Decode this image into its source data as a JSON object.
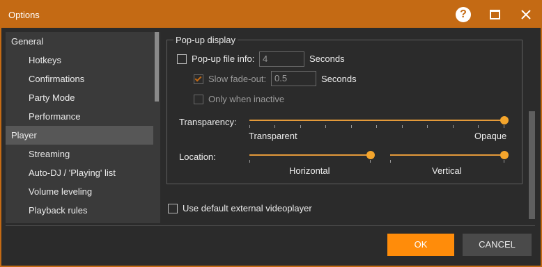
{
  "window": {
    "title": "Options"
  },
  "titlebar": {
    "help_glyph": "?",
    "close_glyph": "✕"
  },
  "sidebar": {
    "items": [
      {
        "label": "General",
        "level": 0
      },
      {
        "label": "Hotkeys",
        "level": 1
      },
      {
        "label": "Confirmations",
        "level": 1
      },
      {
        "label": "Party Mode",
        "level": 1
      },
      {
        "label": "Performance",
        "level": 1
      },
      {
        "label": "Player",
        "level": 0,
        "selected": true
      },
      {
        "label": "Streaming",
        "level": 1
      },
      {
        "label": "Auto-DJ / 'Playing' list",
        "level": 1
      },
      {
        "label": "Volume leveling",
        "level": 1
      },
      {
        "label": "Playback rules",
        "level": 1
      }
    ]
  },
  "popup": {
    "group_title": "Pop-up display",
    "file_info": {
      "label": "Pop-up file info:",
      "checked": false,
      "value": "4",
      "unit": "Seconds"
    },
    "slow_fade": {
      "label": "Slow fade-out:",
      "checked": true,
      "disabled": true,
      "value": "0.5",
      "unit": "Seconds"
    },
    "only_inactive": {
      "label": "Only when inactive",
      "checked": false,
      "disabled": true
    },
    "transparency": {
      "label": "Transparency:",
      "min_label": "Transparent",
      "max_label": "Opaque",
      "value": 1.0
    },
    "location": {
      "label": "Location:",
      "horizontal_label": "Horizontal",
      "horizontal_value": 1.0,
      "vertical_label": "Vertical",
      "vertical_value": 1.0
    }
  },
  "videoplayer": {
    "label": "Use default external videoplayer",
    "checked": false
  },
  "buttons": {
    "ok": "OK",
    "cancel": "CANCEL"
  },
  "colors": {
    "accent": "#c46a14",
    "button_primary": "#ff8c0a",
    "slider": "#f4a52c",
    "background": "#2b2b2b"
  }
}
